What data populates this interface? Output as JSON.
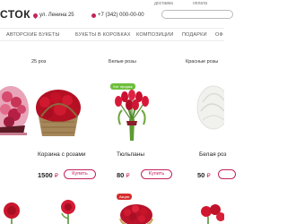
{
  "topnav": {
    "delivery": "доставка",
    "payment": "оплата"
  },
  "header": {
    "logo": "СТОК",
    "address": "ул. Ленина 25",
    "phone": "+7 (342) 000-00-00"
  },
  "menu": [
    "АВТОРСКИЕ БУКЕТЫ",
    "БУКЕТЫ В КОРОБКАХ",
    "КОМПОЗИЦИИ",
    "ПОДАРКИ",
    "ОФ"
  ],
  "categories": [
    "25 роз",
    "Белые розы",
    "Красные розы"
  ],
  "products": [
    {
      "name": "Корзина с розами",
      "price": "1500",
      "currency": "₽",
      "buy": "Купить"
    },
    {
      "name": "Тюльпаны",
      "price": "80",
      "currency": "₽",
      "buy": "Купить",
      "badge": "Хит продаж"
    },
    {
      "name": "Белая роз",
      "price": "50",
      "currency": "₽"
    }
  ],
  "badges": {
    "sale": "Акция"
  },
  "colors": {
    "accent": "#c4235e",
    "badge_green": "#6dbf3a",
    "badge_red": "#d62e2e"
  }
}
